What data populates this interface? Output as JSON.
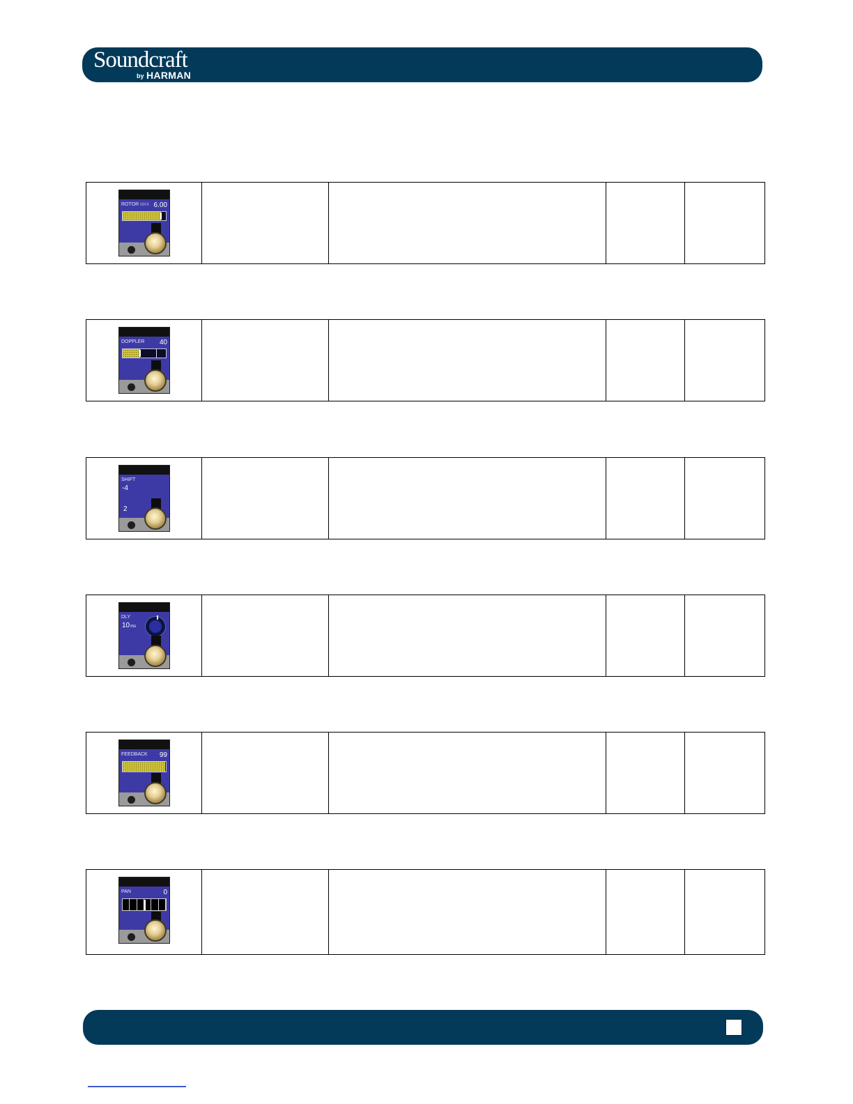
{
  "header": {
    "brand": "Soundcraft",
    "brand_by": "by",
    "brand_sub": "HARMAN"
  },
  "rows": [
    {
      "widget": {
        "label": "ROTOR",
        "sublabel": "MAX",
        "value": "6.00",
        "type": "bar",
        "level": 0.88
      }
    },
    {
      "widget": {
        "label": "DOPPLER",
        "value": "40",
        "type": "bar",
        "level": 0.4
      }
    },
    {
      "widget": {
        "label": "SHIFT",
        "value": "-4",
        "value2": "2",
        "type": "shift"
      }
    },
    {
      "widget": {
        "label": "DLY",
        "value": "10",
        "unit": "ms",
        "type": "ring"
      }
    },
    {
      "widget": {
        "label": "FEEDBACK",
        "value": "99",
        "type": "bar",
        "level": 0.99
      }
    },
    {
      "widget": {
        "label": "PAN",
        "value": "0",
        "type": "pan",
        "level": 0.5
      }
    }
  ],
  "colors": {
    "header_bg": "#033a5a",
    "widget_bg": "#3d3aa6",
    "bar_fill": "#cfc43c",
    "knob": "#e4cf95"
  }
}
